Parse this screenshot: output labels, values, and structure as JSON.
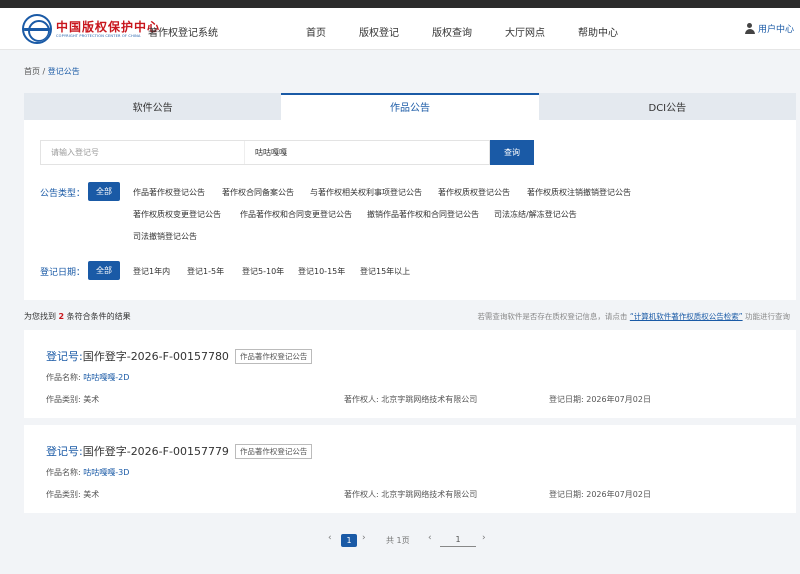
{
  "header": {
    "logo_cn": "中国版权保护中心",
    "logo_en": "COPYRIGHT PROTECTION CENTER OF CHINA",
    "system_name": "著作权登记系统",
    "nav": [
      "首页",
      "版权登记",
      "版权查询",
      "大厅网点",
      "帮助中心"
    ],
    "user_label": "用户中心"
  },
  "breadcrumb": {
    "home": "首页",
    "sep": "/",
    "current": "登记公告"
  },
  "tabs": [
    {
      "label": "软件公告",
      "active": false
    },
    {
      "label": "作品公告",
      "active": true
    },
    {
      "label": "DCI公告",
      "active": false
    }
  ],
  "search": {
    "reg_placeholder": "请输入登记号",
    "keyword_value": "咕咕嘎嘎",
    "button": "查询"
  },
  "filters": {
    "type_label": "公告类型：",
    "type_all": "全部",
    "type_options": [
      "作品著作权登记公告",
      "著作权合同备案公告",
      "与著作权相关权利事项登记公告",
      "著作权质权登记公告",
      "著作权质权注销撤销登记公告",
      "著作权质权变更登记公告",
      "作品著作权和合同变更登记公告",
      "撤销作品著作权和合同登记公告",
      "司法冻结/解冻登记公告",
      "司法撤销登记公告"
    ],
    "date_label": "登记日期：",
    "date_all": "全部",
    "date_options": [
      "登记1年内",
      "登记1-5年",
      "登记5-10年",
      "登记10-15年",
      "登记15年以上"
    ]
  },
  "results": {
    "prefix": "为您找到",
    "count": "2",
    "suffix": "条符合条件的结果",
    "hint_pre": "若需查询软件是否存在质权登记信息，请点击",
    "hint_link": "“计算机软件著作权质权公告检索”",
    "hint_post": "功能进行查询"
  },
  "cards": [
    {
      "reg_label": "登记号:",
      "reg_no": "国作登字-2026-F-00157780",
      "tag": "作品著作权登记公告",
      "name_label": "作品名称:",
      "name": "咕咕嘎嘎-2D",
      "category": "作品类别: 美术",
      "owner": "著作权人: 北京字跳网络技术有限公司",
      "date": "登记日期: 2026年07月02日"
    },
    {
      "reg_label": "登记号:",
      "reg_no": "国作登字-2026-F-00157779",
      "tag": "作品著作权登记公告",
      "name_label": "作品名称:",
      "name": "咕咕嘎嘎-3D",
      "category": "作品类别: 美术",
      "owner": "著作权人: 北京字跳网络技术有限公司",
      "date": "登记日期: 2026年07月02日"
    }
  ],
  "pager": {
    "prev": "‹",
    "current": "1",
    "next": "›",
    "total": "共 1页",
    "jump_prev": "‹",
    "jump_value": "1",
    "jump_next": "›"
  }
}
